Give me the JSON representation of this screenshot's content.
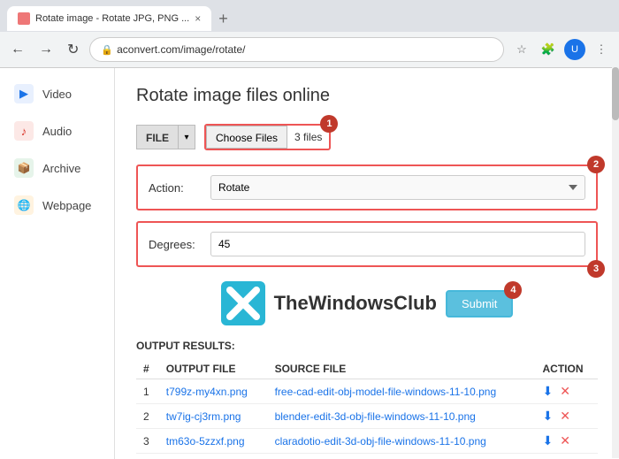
{
  "browser": {
    "tab_title": "Rotate image - Rotate JPG, PNG ...",
    "tab_close": "×",
    "new_tab": "+",
    "address": "aconvert.com/image/rotate/",
    "nav_back": "←",
    "nav_forward": "→",
    "nav_refresh": "↻"
  },
  "sidebar": {
    "items": [
      {
        "id": "video",
        "label": "Video",
        "icon": "▶"
      },
      {
        "id": "audio",
        "label": "Audio",
        "icon": "♪"
      },
      {
        "id": "archive",
        "label": "Archive",
        "icon": "📦"
      },
      {
        "id": "webpage",
        "label": "Webpage",
        "icon": "🌐"
      }
    ]
  },
  "main": {
    "page_title": "Rotate image files online",
    "file_label": "FILE",
    "choose_files_btn": "Choose Files",
    "files_count": "3 files",
    "badge1": "1",
    "action_label": "Action:",
    "action_value": "Rotate",
    "badge2": "2",
    "degrees_label": "Degrees:",
    "degrees_value": "45",
    "badge3": "3",
    "submit_label": "Submit",
    "badge4": "4",
    "watermark_text": "TheWindowsClub",
    "output_title": "OUTPUT RESULTS:",
    "table": {
      "headers": [
        "#",
        "OUTPUT FILE",
        "SOURCE FILE",
        "ACTION"
      ],
      "rows": [
        {
          "num": "1",
          "output": "t799z-my4xn.png",
          "source": "free-cad-edit-obj-model-file-windows-11-10.png"
        },
        {
          "num": "2",
          "output": "tw7ig-cj3rm.png",
          "source": "blender-edit-3d-obj-file-windows-11-10.png"
        },
        {
          "num": "3",
          "output": "tm63o-5zzxf.png",
          "source": "claradotio-edit-3d-obj-file-windows-11-10.png"
        }
      ]
    }
  }
}
